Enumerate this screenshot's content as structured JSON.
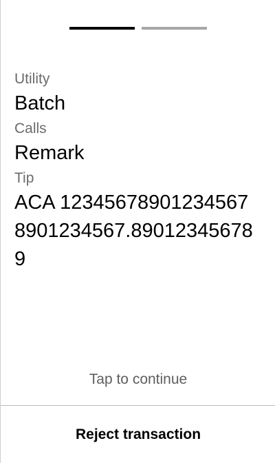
{
  "pager": {
    "total_pages": 2,
    "current_page": 1
  },
  "fields": [
    {
      "label": "Utility",
      "value": "Batch"
    },
    {
      "label": "Calls",
      "value": "Remark"
    },
    {
      "label": "Tip",
      "value": "ACA 123456789012345678901234567.890123456789"
    }
  ],
  "footer": {
    "continue_hint": "Tap to continue",
    "reject_label": "Reject transaction"
  },
  "colors": {
    "pager_active": "#000000",
    "pager_inactive": "#a6a6a6",
    "label": "#6b6b6b"
  }
}
